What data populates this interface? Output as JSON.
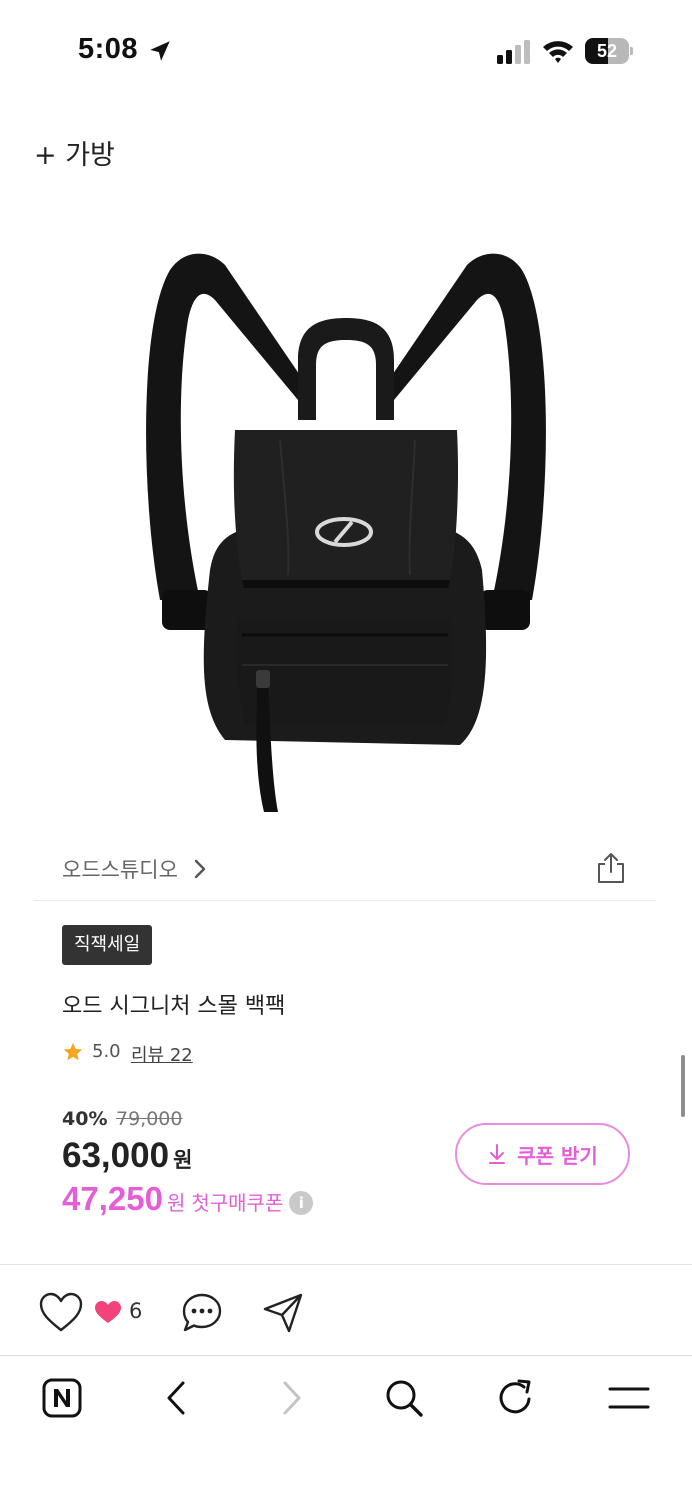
{
  "status_bar": {
    "time": "5:08",
    "battery_level": "52",
    "battery_fraction": 0.52
  },
  "category": {
    "label": "+ 가방"
  },
  "product": {
    "image_alt_icon": "black-backpack-image",
    "brand": "오드스튜디오",
    "badge": "직잭세일",
    "title": "오드 시그니처 스몰 백팩",
    "rating": "5.0",
    "review_label": "리뷰 22",
    "discount_rate": "40%",
    "original_price": "79,000",
    "sale_price": "63,000",
    "sale_unit": "원",
    "coupon_price": "47,250",
    "coupon_unit": "원",
    "coupon_label": "첫구매쿠폰",
    "info_icon": "i",
    "coupon_button_label": "쿠폰 받기"
  },
  "actions": {
    "like_count": "6"
  },
  "colors": {
    "accent_pink": "#e45fd6",
    "coupon_border": "#e78ce0",
    "badge_bg": "#333333",
    "star": "#f5a623",
    "heart_filled": "#f2437a"
  },
  "icons": {
    "status": [
      "location-arrow-icon",
      "signal-icon",
      "wifi-icon",
      "battery-icon"
    ],
    "product": [
      "chevron-right-icon",
      "share-icon",
      "star-icon",
      "download-icon",
      "info-icon"
    ],
    "actions": [
      "heart-outline-icon",
      "heart-filled-icon",
      "comment-icon",
      "send-icon"
    ],
    "nav": [
      "naver-n-icon",
      "back-icon",
      "forward-icon",
      "search-icon",
      "refresh-icon",
      "menu-icon"
    ]
  }
}
